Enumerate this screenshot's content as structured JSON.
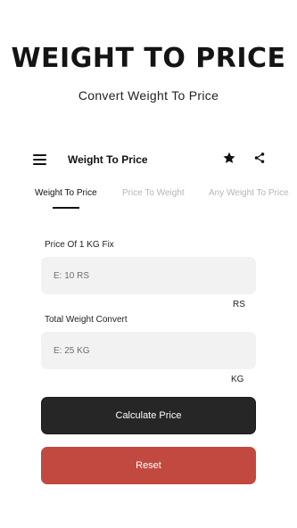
{
  "promo": {
    "headline": "WEIGHT TO PRICE",
    "subline": "Convert Weight To Price"
  },
  "toolbar": {
    "title": "Weight To Price",
    "menu_icon": "hamburger-menu-icon",
    "favorite_icon": "star-icon",
    "share_icon": "share-icon"
  },
  "tabs": [
    {
      "label": "Weight To Price",
      "active": true
    },
    {
      "label": "Price To Weight",
      "active": false
    },
    {
      "label": "Any Weight To Price",
      "active": false
    }
  ],
  "form": {
    "price_label": "Price Of 1 KG Fix",
    "price_placeholder": "E: 10 RS",
    "price_unit": "RS",
    "weight_label": "Total Weight Convert",
    "weight_placeholder": "E: 25 KG",
    "weight_unit": "KG"
  },
  "buttons": {
    "calculate_label": "Calculate Price",
    "reset_label": "Reset"
  },
  "colors": {
    "primary_button": "#262626",
    "reset_button": "#c2493f",
    "field_background": "#f2f2f2",
    "inactive_tab": "#b5b5b5"
  }
}
